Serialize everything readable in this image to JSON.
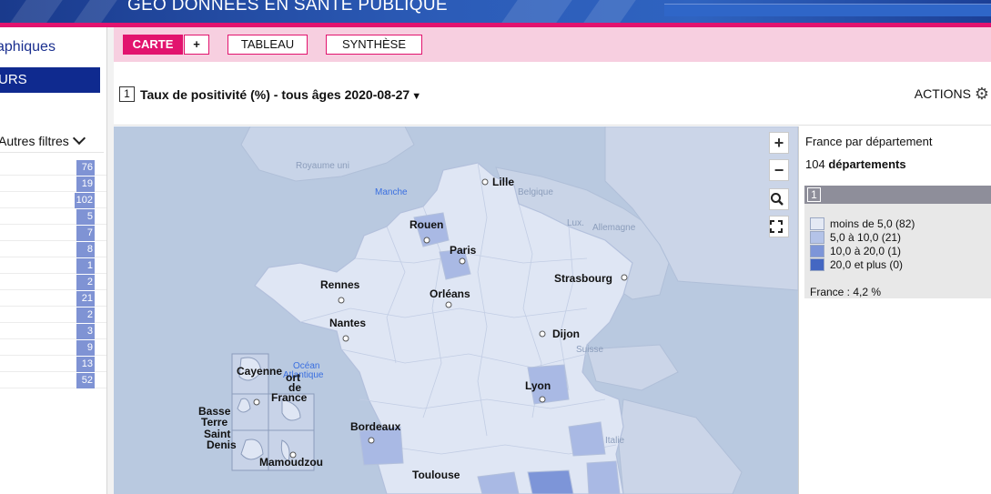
{
  "banner": {
    "title": "GÉO DONNÉES EN SANTÉ PUBLIQUE"
  },
  "left_panel": {
    "heading": "aphiques",
    "tab": "URS",
    "filter": "Autres filtres",
    "counts": [
      "76",
      "19",
      "102",
      "5",
      "7",
      "8",
      "1",
      "2",
      "21",
      "2",
      "3",
      "9",
      "13",
      "52"
    ]
  },
  "tabs": {
    "carte": "CARTE",
    "plus": "+",
    "tableau": "TABLEAU",
    "synthese": "SYNTHÈSE"
  },
  "indicator": {
    "number": "1",
    "title": "Taux de positivité (%) - tous âges",
    "date": "2020-08-27",
    "caret": "▼"
  },
  "actions": {
    "label": "ACTIONS",
    "icon": "gear-icon"
  },
  "map": {
    "zoom_in": "+",
    "zoom_out": "−",
    "search_icon": "search-icon",
    "fullscreen_icon": "fullscreen-icon",
    "cities": {
      "lille": "Lille",
      "rouen": "Rouen",
      "paris": "Paris",
      "strasbourg": "Strasbourg",
      "rennes": "Rennes",
      "orleans": "Orléans",
      "nantes": "Nantes",
      "dijon": "Dijon",
      "lyon": "Lyon",
      "bordeaux": "Bordeaux",
      "toulouse": "Toulouse"
    },
    "countries": {
      "royaume_uni": "Royaume uni",
      "belgique": "Belgique",
      "lux": "Lux.",
      "allemagne": "Allemagne",
      "suisse": "Suisse",
      "italie": "Italie"
    },
    "seas": {
      "manche": "Manche",
      "ocean_line1": "Océan",
      "ocean_line2": "Atlantique"
    },
    "overseas": {
      "cayenne": "Cayenne",
      "fort1": "ort",
      "fort2": "de",
      "fort3": "France",
      "basse": "Basse",
      "terre": "Terre",
      "saint": "Saint",
      "denis": "Denis",
      "mamoudzou": "Mamoudzou"
    },
    "colors": {
      "class1": "#dfe6f4",
      "class2": "#a9b9e4",
      "class3": "#7d95d8",
      "class4": "#4467c2"
    }
  },
  "legend": {
    "title": "France par département",
    "count_num": "104",
    "count_label": "départements",
    "indicator_number": "1",
    "items": [
      {
        "label": "moins de 5,0 (82)",
        "color": "#e4e9f4"
      },
      {
        "label": "5,0 à 10,0 (21)",
        "color": "#b4c3e8"
      },
      {
        "label": "10,0 à 20,0 (1)",
        "color": "#7d95d8"
      },
      {
        "label": "20,0 et plus (0)",
        "color": "#4467c2"
      }
    ],
    "france": "France : 4,2 %"
  }
}
